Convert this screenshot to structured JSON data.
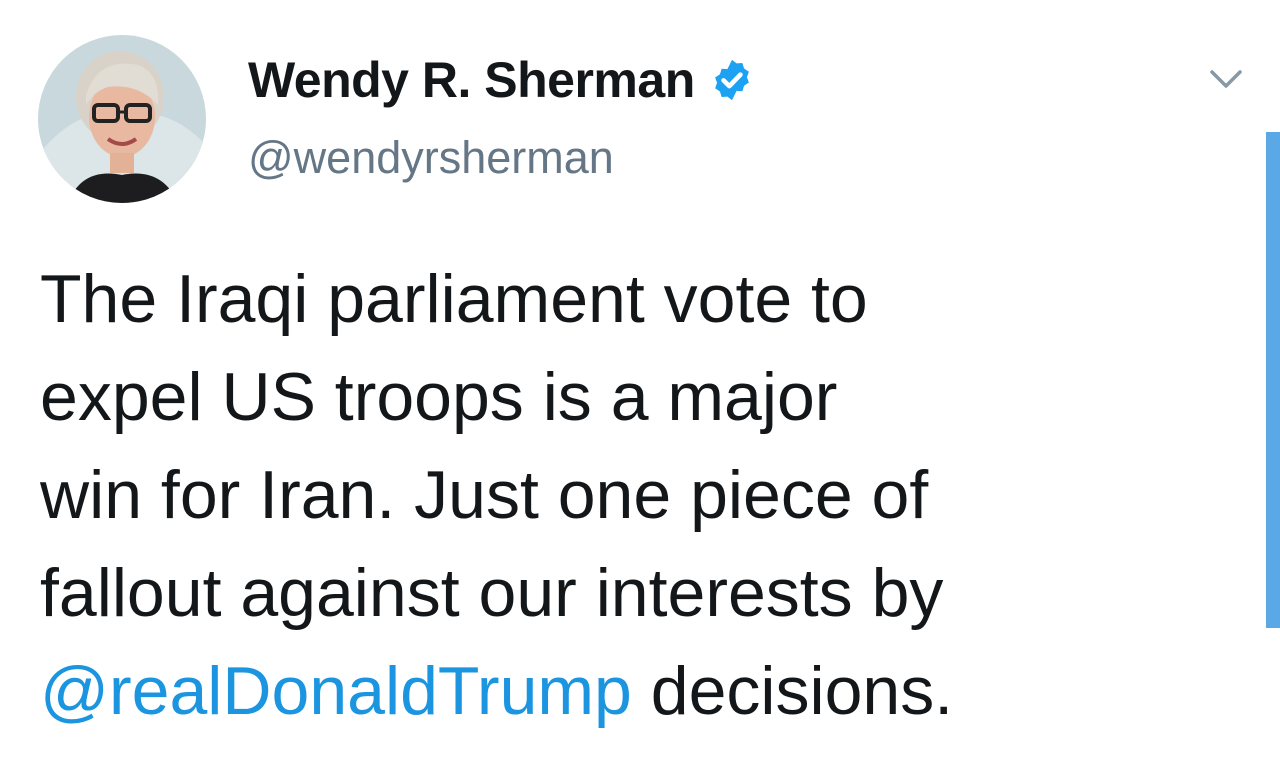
{
  "tweet": {
    "author": {
      "display_name": "Wendy R. Sherman",
      "handle": "@wendyrsherman",
      "verified": true,
      "avatar_icon": "profile-photo"
    },
    "body": {
      "line1": "The Iraqi parliament vote to",
      "line2": "expel US troops is a major",
      "line3": "win for Iran. Just one piece of",
      "line4": "fallout against our interests by",
      "mention": "@realDonaldTrump",
      "line5_rest": " decisions."
    },
    "menu_icon": "chevron-down-icon"
  },
  "colors": {
    "text": "#14171a",
    "secondary_text": "#657786",
    "link": "#1b95e0",
    "verified_badge": "#1da1f2",
    "scrollbar": "#5aa9e6"
  }
}
